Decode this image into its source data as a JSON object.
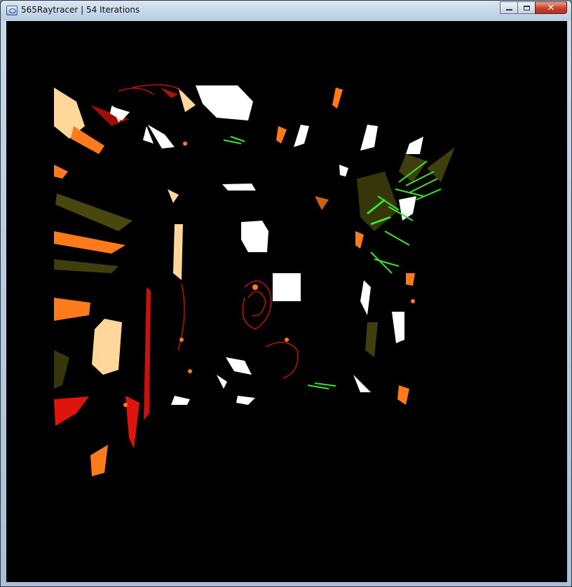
{
  "window": {
    "title": "565Raytracer | 54 Iterations",
    "icon": "app-window-icon",
    "controls": {
      "minimize_icon": "minimize-icon",
      "maximize_icon": "maximize-icon",
      "close_label": "✕"
    }
  },
  "render": {
    "background_color": "#000000",
    "palette": {
      "white": "#ffffff",
      "cream": "#ffd79a",
      "orange": "#ff7a1a",
      "red": "#e0140e",
      "green": "#39e62a",
      "olive": "#5a5a12"
    }
  }
}
